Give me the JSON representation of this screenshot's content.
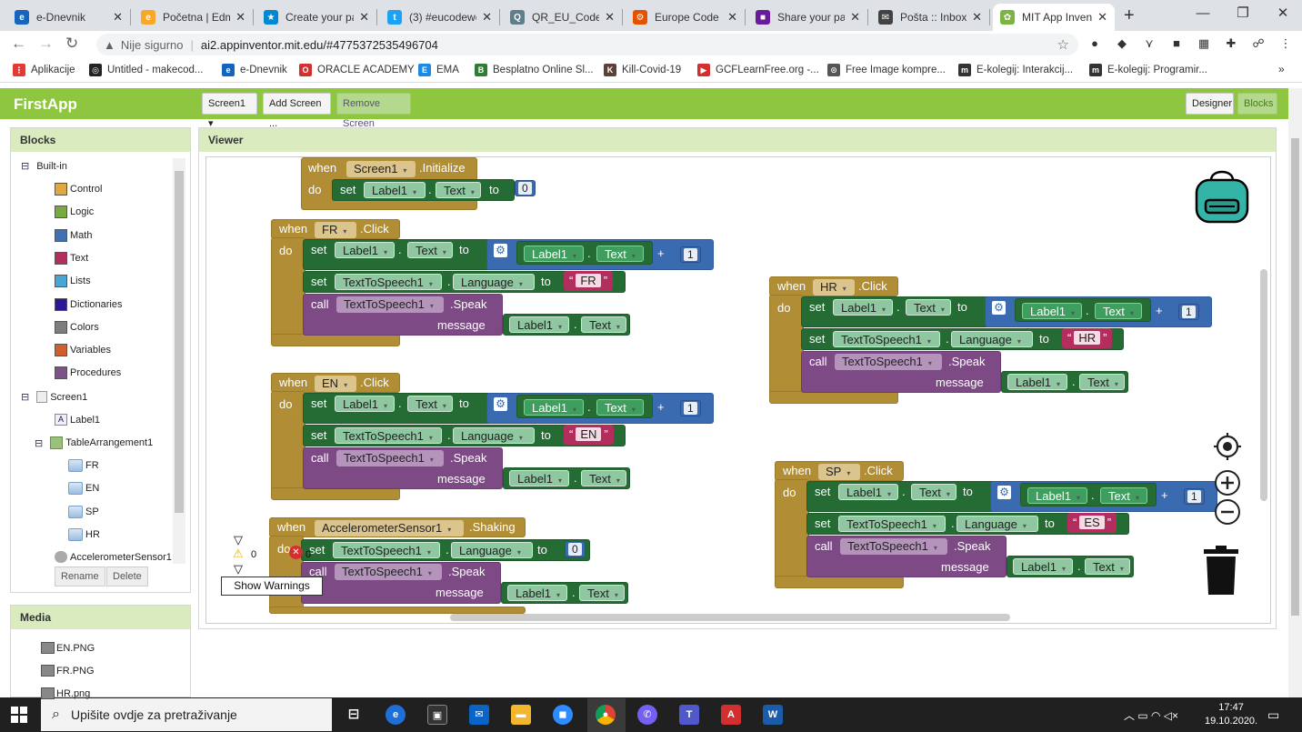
{
  "browser": {
    "tabs": [
      {
        "label": "e-Dnevnik",
        "color": "#1565c0",
        "glyph": "e"
      },
      {
        "label": "Početna | Edmo",
        "color": "#f9a825",
        "glyph": "e"
      },
      {
        "label": "Create your pa",
        "color": "#0288d1",
        "glyph": "★"
      },
      {
        "label": "(3) #eucodewe",
        "color": "#1da1f2",
        "glyph": "t"
      },
      {
        "label": "QR_EU_Code_W",
        "color": "#607d8b",
        "glyph": "Q"
      },
      {
        "label": "Europe Code W",
        "color": "#e65100",
        "glyph": "⚙"
      },
      {
        "label": "Share your pap",
        "color": "#6a1b9a",
        "glyph": "■"
      },
      {
        "label": "Pošta :: Inbox",
        "color": "#424242",
        "glyph": "✉"
      },
      {
        "label": "MIT App Invent",
        "color": "#7cb342",
        "glyph": "✿"
      }
    ],
    "url_warning": "Nije sigurno",
    "url": "ai2.appinventor.mit.edu/#4775372535496704",
    "bookmarks": [
      {
        "label": "Aplikacije",
        "color": "#e53935",
        "glyph": "⋮"
      },
      {
        "label": "Untitled - makecod...",
        "color": "#222",
        "glyph": "◎"
      },
      {
        "label": "e-Dnevnik",
        "color": "#1565c0",
        "glyph": "e"
      },
      {
        "label": "ORACLE ACADEMY",
        "color": "#d32f2f",
        "glyph": "O"
      },
      {
        "label": "EMA",
        "color": "#1e88e5",
        "glyph": "E"
      },
      {
        "label": "Besplatno Online Sl...",
        "color": "#2e7d32",
        "glyph": "B"
      },
      {
        "label": "Kill-Covid-19",
        "color": "#5d4037",
        "glyph": "K"
      },
      {
        "label": "GCFLearnFree.org -...",
        "color": "#d32f2f",
        "glyph": "▶"
      },
      {
        "label": "Free Image kompre...",
        "color": "#555",
        "glyph": "⊙"
      },
      {
        "label": "E-kolegij: Interakcij...",
        "color": "#333",
        "glyph": "m"
      },
      {
        "label": "E-kolegij: Programir...",
        "color": "#333",
        "glyph": "m"
      }
    ]
  },
  "app": {
    "name": "FirstApp",
    "screen_select": "Screen1",
    "add_screen": "Add Screen ...",
    "remove_screen": "Remove Screen",
    "designer": "Designer",
    "blocks": "Blocks",
    "accent": "#8ec63f"
  },
  "blocks_panel": {
    "title": "Blocks",
    "builtin": "Built-in",
    "builtin_items": [
      {
        "label": "Control",
        "color": "#e1a93b"
      },
      {
        "label": "Logic",
        "color": "#77ab41"
      },
      {
        "label": "Math",
        "color": "#3f71b5"
      },
      {
        "label": "Text",
        "color": "#b32d5e"
      },
      {
        "label": "Lists",
        "color": "#49a6d4"
      },
      {
        "label": "Dictionaries",
        "color": "#2d1799"
      },
      {
        "label": "Colors",
        "color": "#7d7d7d"
      },
      {
        "label": "Variables",
        "color": "#d05f2d"
      },
      {
        "label": "Procedures",
        "color": "#7c5385"
      }
    ],
    "screen": "Screen1",
    "label1": "Label1",
    "table": "TableArrangement1",
    "buttons": [
      "FR",
      "EN",
      "SP",
      "HR"
    ],
    "accel": "AccelerometerSensor1",
    "rename": "Rename",
    "delete": "Delete"
  },
  "media": {
    "title": "Media",
    "files": [
      "EN.PNG",
      "FR.PNG",
      "HR.png"
    ]
  },
  "viewer": {
    "title": "Viewer",
    "warnings_count": "0",
    "errors_count": "0",
    "show_warnings": "Show Warnings",
    "w": {
      "when": "when",
      "do": "do",
      "set": "set",
      "to": "to",
      "call": "call",
      "message": "message",
      "dot": "."
    },
    "init": {
      "comp": "Screen1",
      "event": ".Initialize",
      "label": "Label1",
      "prop": "Text",
      "value": "0"
    },
    "handlers": [
      {
        "btn": "FR",
        "lang": "FR"
      },
      {
        "btn": "EN",
        "lang": "EN"
      },
      {
        "btn": "HR",
        "lang": "HR"
      },
      {
        "btn": "SP",
        "lang": "ES"
      }
    ],
    "click": ".Click",
    "label": "Label1",
    "text": "Text",
    "tts": "TextToSpeech1",
    "language": "Language",
    "speak": ".Speak",
    "plus": "+",
    "one": "1",
    "shake": {
      "comp": "AccelerometerSensor1",
      "event": ".Shaking",
      "value": "0"
    }
  },
  "taskbar": {
    "search": "Upišite ovdje za pretraživanje",
    "time": "17:47",
    "date": "19.10.2020."
  }
}
